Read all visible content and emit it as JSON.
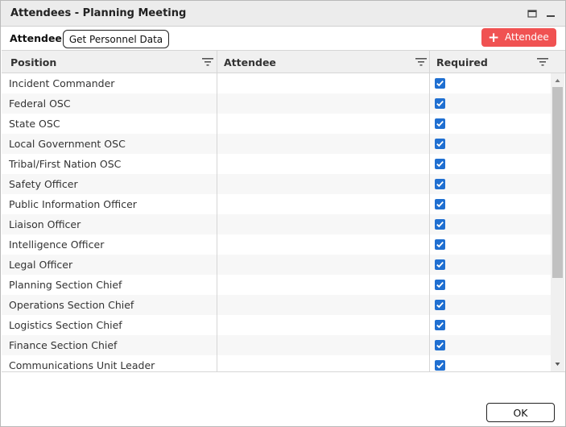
{
  "window": {
    "title": "Attendees - Planning Meeting"
  },
  "toolbar": {
    "attendee_label": "Attendee",
    "get_personnel_label": "Get Personnel Data",
    "add_attendee_label": "Attendee"
  },
  "grid": {
    "columns": [
      "Position",
      "Attendee",
      "Required"
    ],
    "rows": [
      {
        "position": "Incident Commander",
        "attendee": "",
        "required": true
      },
      {
        "position": "Federal OSC",
        "attendee": "",
        "required": true
      },
      {
        "position": "State OSC",
        "attendee": "",
        "required": true
      },
      {
        "position": "Local Government OSC",
        "attendee": "",
        "required": true
      },
      {
        "position": "Tribal/First Nation OSC",
        "attendee": "",
        "required": true
      },
      {
        "position": "Safety Officer",
        "attendee": "",
        "required": true
      },
      {
        "position": "Public Information Officer",
        "attendee": "",
        "required": true
      },
      {
        "position": "Liaison Officer",
        "attendee": "",
        "required": true
      },
      {
        "position": "Intelligence Officer",
        "attendee": "",
        "required": true
      },
      {
        "position": "Legal Officer",
        "attendee": "",
        "required": true
      },
      {
        "position": "Planning Section Chief",
        "attendee": "",
        "required": true
      },
      {
        "position": "Operations Section Chief",
        "attendee": "",
        "required": true
      },
      {
        "position": "Logistics Section Chief",
        "attendee": "",
        "required": true
      },
      {
        "position": "Finance Section Chief",
        "attendee": "",
        "required": true
      },
      {
        "position": "Communications Unit Leader",
        "attendee": "",
        "required": true
      }
    ]
  },
  "footer": {
    "ok_label": "OK"
  },
  "colors": {
    "accent_red": "#f05252",
    "checkbox_blue": "#1f6fd1"
  },
  "icons": {
    "maximize": "maximize-icon",
    "minimize": "minimize-icon",
    "add": "plus-icon",
    "filter": "filter-icon",
    "check": "checkmark-icon"
  }
}
